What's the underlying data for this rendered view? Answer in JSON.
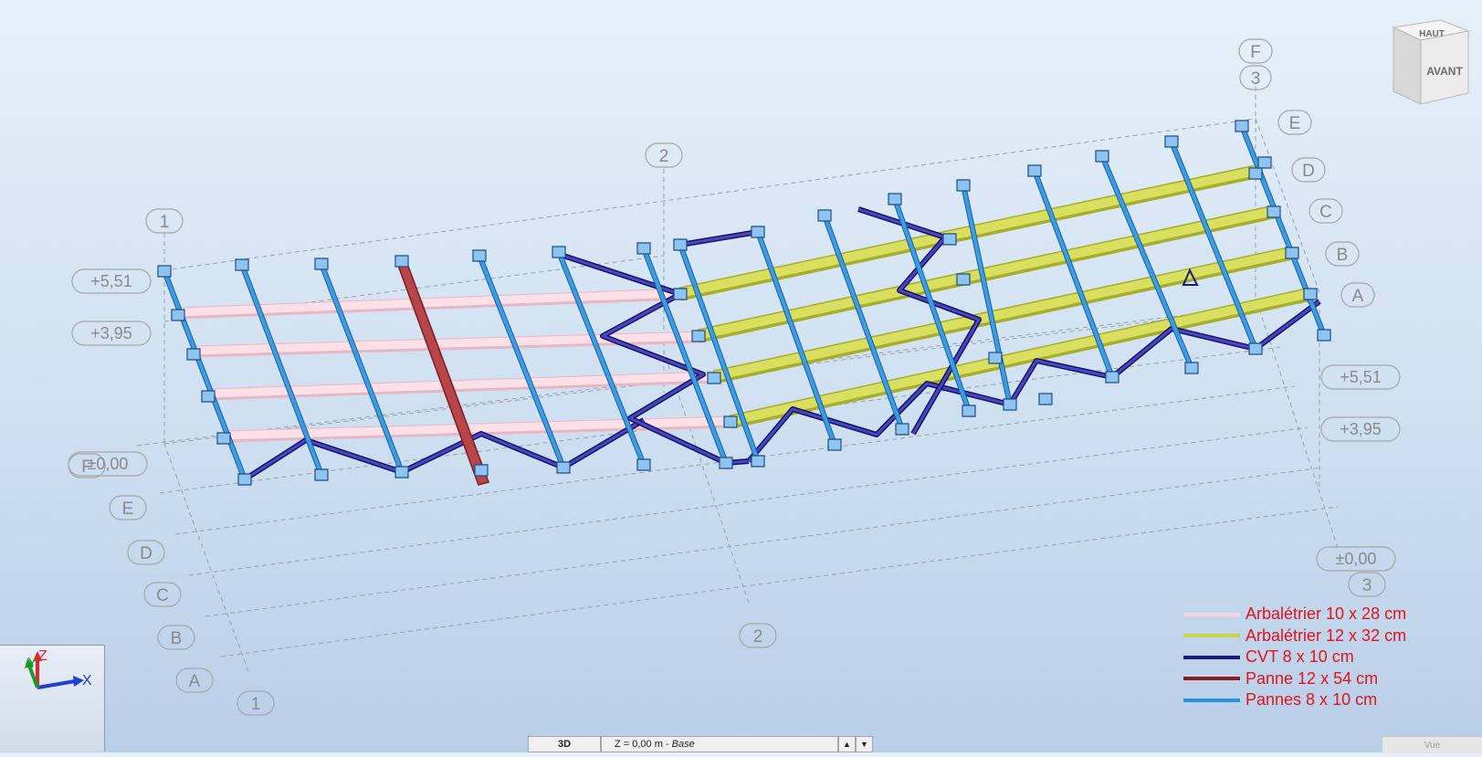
{
  "viewport": {
    "grid_lines_near": {
      "numbers": [
        "1",
        "2",
        "3"
      ],
      "letters": [
        "A",
        "B",
        "C",
        "D",
        "E",
        "F"
      ]
    },
    "grid_lines_far": {
      "numbers": [
        "1",
        "2",
        "3"
      ],
      "letters": [
        "A",
        "B",
        "C",
        "D",
        "E",
        "F"
      ]
    },
    "elevations_left": [
      "+5,51",
      "+3,95",
      "±0,00"
    ],
    "elevations_right": [
      "+5,51",
      "+3,95",
      "±0,00"
    ]
  },
  "view_cube": {
    "top_face": "HAUT",
    "front_face": "AVANT"
  },
  "axis_triad": {
    "x": "X",
    "y": "Y",
    "z": "Z"
  },
  "legend": [
    {
      "label": "Arbalétrier 10 x 28 cm",
      "color": "#f7d3dc"
    },
    {
      "label": "Arbalétrier 12 x 32 cm",
      "color": "#c9d44a"
    },
    {
      "label": "CVT 8 x 10 cm",
      "color": "#1d1b7a"
    },
    {
      "label": "Panne 12 x 54 cm",
      "color": "#8a1c1c"
    },
    {
      "label": "Pannes 8 x 10 cm",
      "color": "#2a8fe0"
    }
  ],
  "status_bar": {
    "view_mode": "3D",
    "level_prefix": "Z = 0,00 m - ",
    "level_name": "Base",
    "up_arrow": "▲",
    "down_arrow": "▼",
    "view_tab": "Vue"
  },
  "colors": {
    "purlin": "#3b9de3",
    "purlin_edge": "#1d5f9c",
    "bracing": "#2b2a8c",
    "rafter_pink": "#fbe0e7",
    "rafter_yellow": "#d9e060",
    "heavy_purlin": "#b8454a",
    "grid_line": "#9aa0a8"
  }
}
